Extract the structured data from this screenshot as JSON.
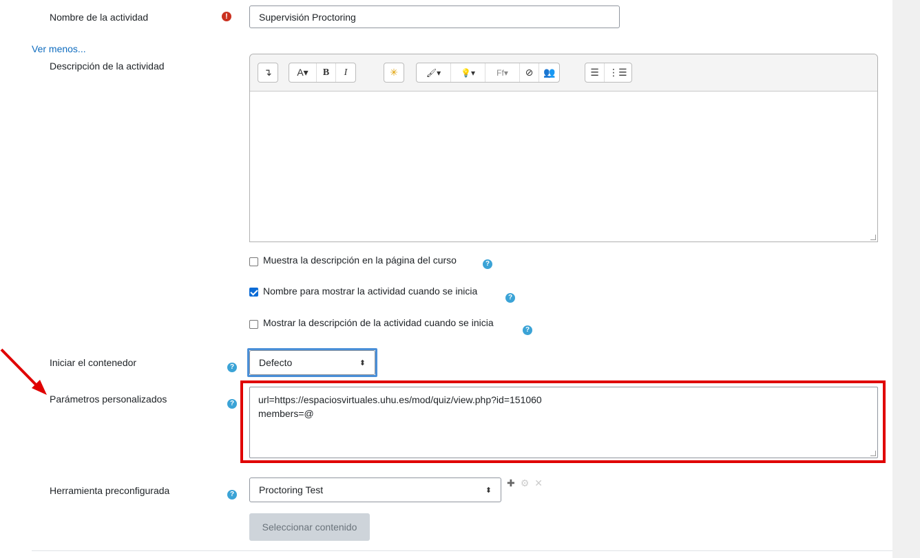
{
  "form": {
    "activity_name_label": "Nombre de la actividad",
    "activity_name_value": "Supervisión Proctoring",
    "show_less_link": "Ver menos...",
    "description_label": "Descripción de la actividad",
    "show_description_label": "Muestra la descripción en la página del curso",
    "show_name_label": "Nombre para mostrar la actividad cuando se inicia",
    "show_activity_description_label": "Mostrar la descripción de la actividad cuando se inicia",
    "launch_container_label": "Iniciar el contenedor",
    "launch_container_value": "Defecto",
    "custom_params_label": "Parámetros personalizados",
    "custom_params_lines": [
      "url=https://espaciosvirtuales.uhu.es/mod/quiz/view.php?id=151060",
      "members=@"
    ],
    "preconfigured_tool_label": "Herramienta preconfigurada",
    "preconfigured_tool_value": "Proctoring Test",
    "select_content_button": "Seleccionar contenido"
  },
  "checkboxes": {
    "show_description": false,
    "show_name": true,
    "show_activity_description": false
  },
  "toolbar": {
    "buttons": [
      "↴",
      "A▾",
      "B",
      "I",
      "✳",
      "🖌▾",
      "💡▾",
      "Ff▾",
      "⊘",
      "👥",
      "☰",
      "⋮☰"
    ]
  },
  "colors": {
    "accent": "#0f6cbf",
    "required": "#ca3120",
    "help": "#3ba3d6",
    "highlight_red": "#e00000",
    "highlight_blue": "#4a8fd8"
  },
  "icons": {
    "required": "exclamation-circle-icon",
    "help": "question-circle-icon",
    "select_arrows": "sort-arrows-icon",
    "add": "plus-icon",
    "configure": "gear-icon",
    "delete": "close-icon"
  }
}
